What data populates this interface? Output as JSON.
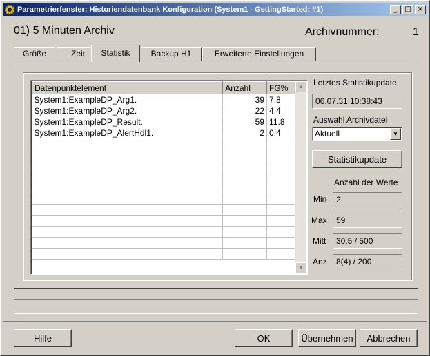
{
  "window": {
    "title": "Parametrierfenster: Historiendatenbank Konfiguration (System1 - GettingStarted; #1)",
    "buttons": {
      "minimize": "_",
      "maximize": "□",
      "close": "×"
    }
  },
  "header": {
    "title": "01) 5 Minuten Archiv",
    "archiv_label": "Archivnummer:",
    "archiv_value": "1"
  },
  "tabs": [
    {
      "label": "Größe",
      "active": false
    },
    {
      "label": "Zeit",
      "active": false
    },
    {
      "label": "Statistik",
      "active": true
    },
    {
      "label": "Backup H1",
      "active": false
    },
    {
      "label": "Erweiterte Einstellungen",
      "active": false
    }
  ],
  "table": {
    "columns": [
      "Datenpunktelement",
      "Anzahl",
      "FG%"
    ],
    "rows": [
      {
        "element": "System1:ExampleDP_Arg1.",
        "anzahl": "39",
        "fg": "7.8"
      },
      {
        "element": "System1:ExampleDP_Arg2.",
        "anzahl": "22",
        "fg": "4.4"
      },
      {
        "element": "System1:ExampleDP_Result.",
        "anzahl": "59",
        "fg": "11.8"
      },
      {
        "element": "System1:ExampleDP_AlertHdl1.",
        "anzahl": "2",
        "fg": "0.4"
      }
    ],
    "empty_rows": 11
  },
  "stats": {
    "last_update_label": "Letztes Statistikupdate",
    "last_update_value": "06.07.31 10:38:43",
    "archive_select_label": "Auswahl Archivdatei",
    "archive_select_value": "Aktuell",
    "update_button": "Statistikupdate",
    "count_label": "Anzahl der Werte",
    "min_label": "Min",
    "min_value": "2",
    "max_label": "Max",
    "max_value": "59",
    "mitt_label": "Mitt",
    "mitt_value": "30.5 / 500",
    "anz_label": "Anz",
    "anz_value": "8(4) / 200"
  },
  "footer": {
    "help": "Hilfe",
    "ok": "OK",
    "apply": "Übernehmen",
    "cancel": "Abbrechen"
  }
}
